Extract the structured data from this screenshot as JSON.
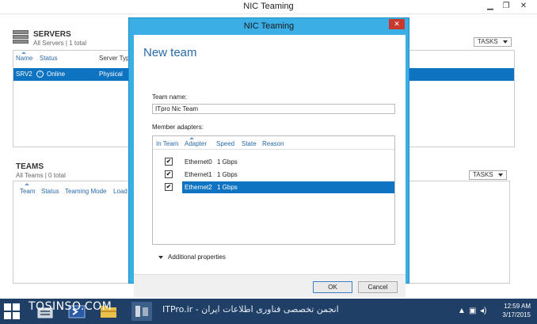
{
  "window": {
    "title": "NIC Teaming"
  },
  "servers": {
    "heading": "SERVERS",
    "subtitle": "All Servers | 1 total",
    "tasks_label": "TASKS",
    "columns": [
      "Name",
      "Status",
      "Server Typ"
    ],
    "rows": [
      {
        "name": "SRV2",
        "status": "Online",
        "type": "Physical"
      }
    ]
  },
  "teams": {
    "heading": "TEAMS",
    "subtitle": "All Teams | 0 total",
    "tasks_label": "TASKS",
    "columns": [
      "Team",
      "Status",
      "Teaming Mode",
      "Load"
    ]
  },
  "dialog": {
    "title": "NIC Teaming",
    "close_glyph": "✕",
    "heading": "New team",
    "team_name_label": "Team name:",
    "team_name_value": "ITpro Nic Team",
    "member_adapters_label": "Member adapters:",
    "columns": [
      "In Team",
      "Adapter",
      "Speed",
      "State",
      "Reason"
    ],
    "adapters": [
      {
        "in_team": true,
        "adapter": "Ethernet0",
        "speed": "1 Gbps",
        "selected": false
      },
      {
        "in_team": true,
        "adapter": "Ethernet1",
        "speed": "1 Gbps",
        "selected": false
      },
      {
        "in_team": true,
        "adapter": "Ethernet2",
        "speed": "1 Gbps",
        "selected": true
      }
    ],
    "additional_properties": "Additional properties",
    "ok_label": "OK",
    "cancel_label": "Cancel"
  },
  "taskbar": {
    "brand": "TOSINSO.COM",
    "watermark": "ITPro.ir - انجمن تخصصی فناوری اطلاعات ایران",
    "time": "12:59 AM",
    "date": "3/17/2015"
  },
  "colors": {
    "accent": "#0e73c1",
    "dialog_frame": "#3baee6",
    "taskbar": "#1f3f66",
    "link_blue": "#2a6aa8"
  }
}
